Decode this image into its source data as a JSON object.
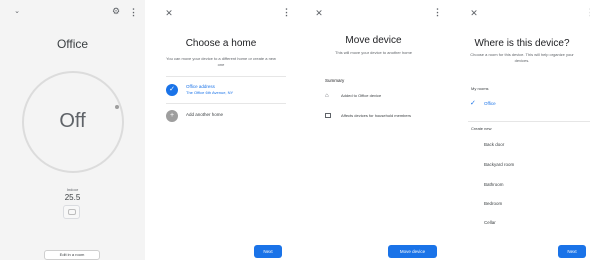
{
  "screen1": {
    "title": "Office",
    "state": "Off",
    "indoor_label": "Indoor",
    "indoor_value": "25.5",
    "edit_button": "Edit in a room"
  },
  "screen2": {
    "title": "Choose a home",
    "subtitle": "You can move your device to a different home or create a new one",
    "homes": [
      {
        "name": "Office address",
        "address": "The Office 6th Avenue, NY",
        "selected": true
      },
      {
        "name": "Add another home",
        "address": "",
        "selected": false
      }
    ],
    "next_button": "Next"
  },
  "screen3": {
    "title": "Move device",
    "subtitle": "This will move your device to another home",
    "summary_label": "Summary",
    "summary_items": [
      {
        "icon": "home-icon",
        "text": "Added to Office device"
      },
      {
        "icon": "devices-icon",
        "text": "Affects devices for household members"
      }
    ],
    "move_button": "Move device"
  },
  "screen4": {
    "title": "Where is this device?",
    "subtitle": "Choose a room for this device. This will help organize your devices.",
    "my_rooms_label": "My rooms",
    "selected_room": "Office",
    "create_new_label": "Create new",
    "rooms": [
      "Back door",
      "Backyard room",
      "Bathroom",
      "Bedroom",
      "Cellar"
    ],
    "next_button": "Next"
  },
  "colors": {
    "accent": "#1a73e8",
    "dial": "#dcdcdc",
    "panel_bg": "#f4f4f4"
  }
}
